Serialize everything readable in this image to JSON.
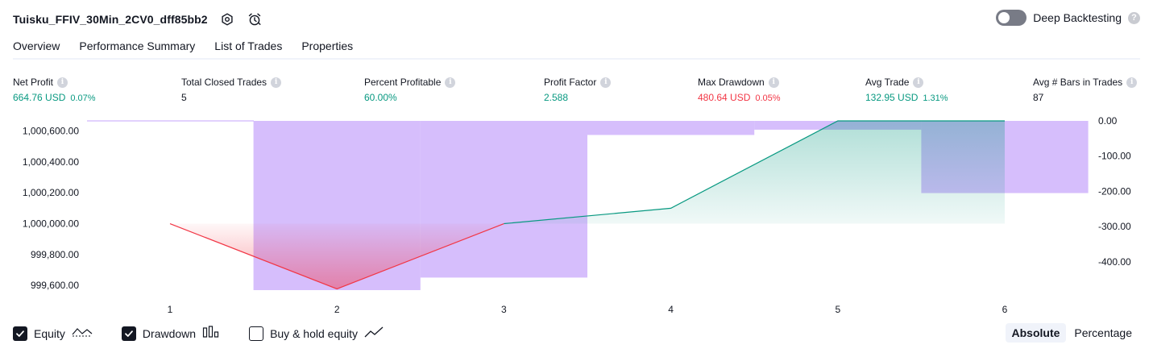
{
  "header": {
    "strategy_name": "Tuisku_FFIV_30Min_2CV0_dff85bb2",
    "settings_icon": "gear-icon",
    "alert_icon": "alarm-clock-icon"
  },
  "deep_backtesting": {
    "label": "Deep Backtesting",
    "enabled": false,
    "help": "?"
  },
  "tabs": [
    {
      "label": "Overview",
      "active": true
    },
    {
      "label": "Performance Summary",
      "active": false
    },
    {
      "label": "List of Trades",
      "active": false
    },
    {
      "label": "Properties",
      "active": false
    }
  ],
  "info_glyph": "i",
  "metrics": [
    {
      "label": "Net Profit",
      "value": "664.76 USD",
      "sub": "0.07%",
      "color": "green"
    },
    {
      "label": "Total Closed Trades",
      "value": "5",
      "sub": "",
      "color": "dark"
    },
    {
      "label": "Percent Profitable",
      "value": "60.00%",
      "sub": "",
      "color": "green"
    },
    {
      "label": "Profit Factor",
      "value": "2.588",
      "sub": "",
      "color": "green"
    },
    {
      "label": "Max Drawdown",
      "value": "480.64 USD",
      "sub": "0.05%",
      "color": "red"
    },
    {
      "label": "Avg Trade",
      "value": "132.95 USD",
      "sub": "1.31%",
      "color": "green"
    },
    {
      "label": "Avg # Bars in Trades",
      "value": "87",
      "sub": "",
      "color": "dark"
    }
  ],
  "colors": {
    "equity_line": "#089981",
    "equity_loss_line": "#f23645",
    "drawdown_fill": "#c5a3fb",
    "positive": "#089981",
    "negative": "#f23645"
  },
  "chart_data": {
    "type": "bar",
    "x": [
      1,
      2,
      3,
      4,
      5,
      6
    ],
    "x_ticks": [
      "1",
      "2",
      "3",
      "4",
      "5",
      "6"
    ],
    "equity": [
      1000000,
      999578,
      1000000,
      1000100,
      1000665,
      1000665
    ],
    "equity_baseline": 1000000,
    "drawdown": [
      0,
      -480.64,
      -445,
      -40,
      -25,
      -205
    ],
    "left_axis": {
      "ylim": [
        999570,
        1000665
      ],
      "ticks": [
        "1,000,600.00",
        "1,000,400.00",
        "1,000,200.00",
        "1,000,000.00",
        "999,800.00",
        "999,600.00"
      ],
      "tick_values": [
        1000600,
        1000400,
        1000200,
        1000000,
        999800,
        999600
      ]
    },
    "right_axis": {
      "ylim": [
        -480.64,
        0
      ],
      "ticks": [
        "0.00",
        "-100.00",
        "-200.00",
        "-300.00",
        "-400.00"
      ],
      "tick_values": [
        0,
        -100,
        -200,
        -300,
        -400
      ]
    },
    "grid": false
  },
  "legend": [
    {
      "label": "Equity",
      "checked": true,
      "icon": "equity-line-icon"
    },
    {
      "label": "Drawdown",
      "checked": true,
      "icon": "drawdown-bars-icon"
    },
    {
      "label": "Buy & hold equity",
      "checked": false,
      "icon": "buy-hold-line-icon"
    }
  ],
  "scale": {
    "absolute_label": "Absolute",
    "percentage_label": "Percentage",
    "selected": "absolute"
  }
}
